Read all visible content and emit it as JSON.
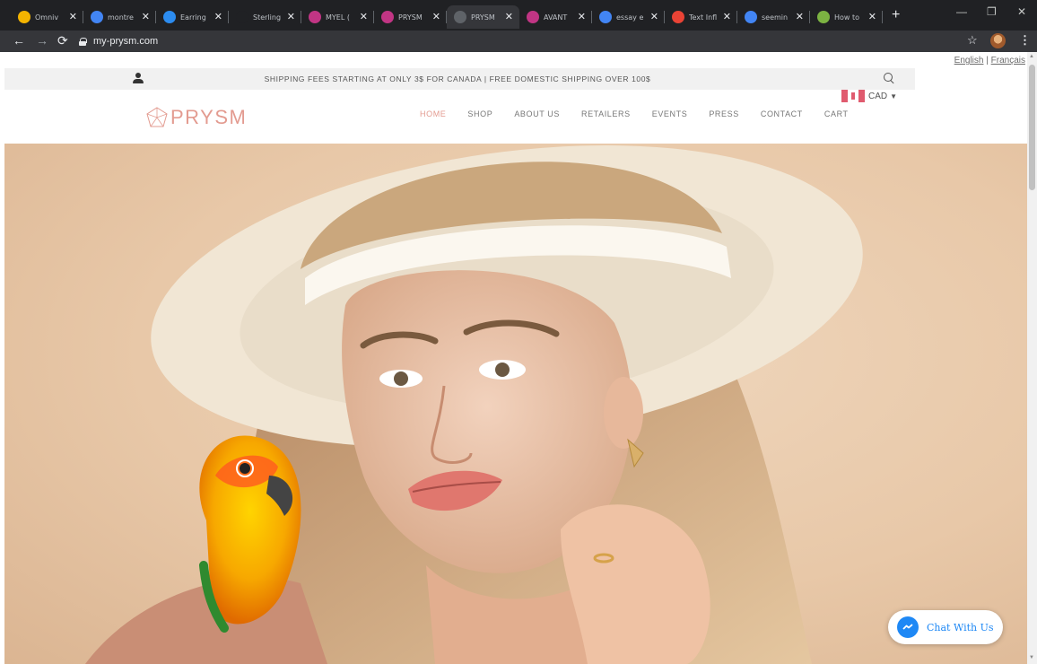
{
  "browser": {
    "tabs": [
      {
        "title": "Omniv",
        "favicon_color": "#f4b400",
        "active": false
      },
      {
        "title": "montre",
        "favicon_color": "#4285f4",
        "active": false
      },
      {
        "title": "Earring",
        "favicon_color": "#2c8cf0",
        "active": false
      },
      {
        "title": "Sterling",
        "favicon_color": "#202124",
        "active": false
      },
      {
        "title": "MYEL (",
        "favicon_color": "#c13584",
        "active": false
      },
      {
        "title": "PRYSM",
        "favicon_color": "#c13584",
        "active": false
      },
      {
        "title": "PRYSM",
        "favicon_color": "#5f6368",
        "active": true
      },
      {
        "title": "AVANT",
        "favicon_color": "#c13584",
        "active": false
      },
      {
        "title": "essay e",
        "favicon_color": "#4285f4",
        "active": false
      },
      {
        "title": "Text Infl",
        "favicon_color": "#ea4335",
        "active": false
      },
      {
        "title": "seemin",
        "favicon_color": "#4285f4",
        "active": false
      },
      {
        "title": "How to",
        "favicon_color": "#7cb342",
        "active": false
      }
    ],
    "new_tab_label": "+",
    "url": "my-prysm.com"
  },
  "site": {
    "language": {
      "english": "English",
      "separator": "|",
      "french": "Français"
    },
    "announcement": "SHIPPING FEES STARTING AT ONLY 3$ FOR CANADA | FREE DOMESTIC SHIPPING OVER 100$",
    "currency": "CAD",
    "logo_text": "PRYSM",
    "nav": [
      {
        "label": "HOME",
        "active": true
      },
      {
        "label": "SHOP",
        "active": false
      },
      {
        "label": "ABOUT US",
        "active": false
      },
      {
        "label": "RETAILERS",
        "active": false
      },
      {
        "label": "EVENTS",
        "active": false
      },
      {
        "label": "PRESS",
        "active": false
      },
      {
        "label": "CONTACT",
        "active": false
      },
      {
        "label": "CART",
        "active": false
      }
    ],
    "chat_label": "Chat With Us",
    "accent_color": "#e39b90",
    "messenger_color": "#1e88f5"
  }
}
